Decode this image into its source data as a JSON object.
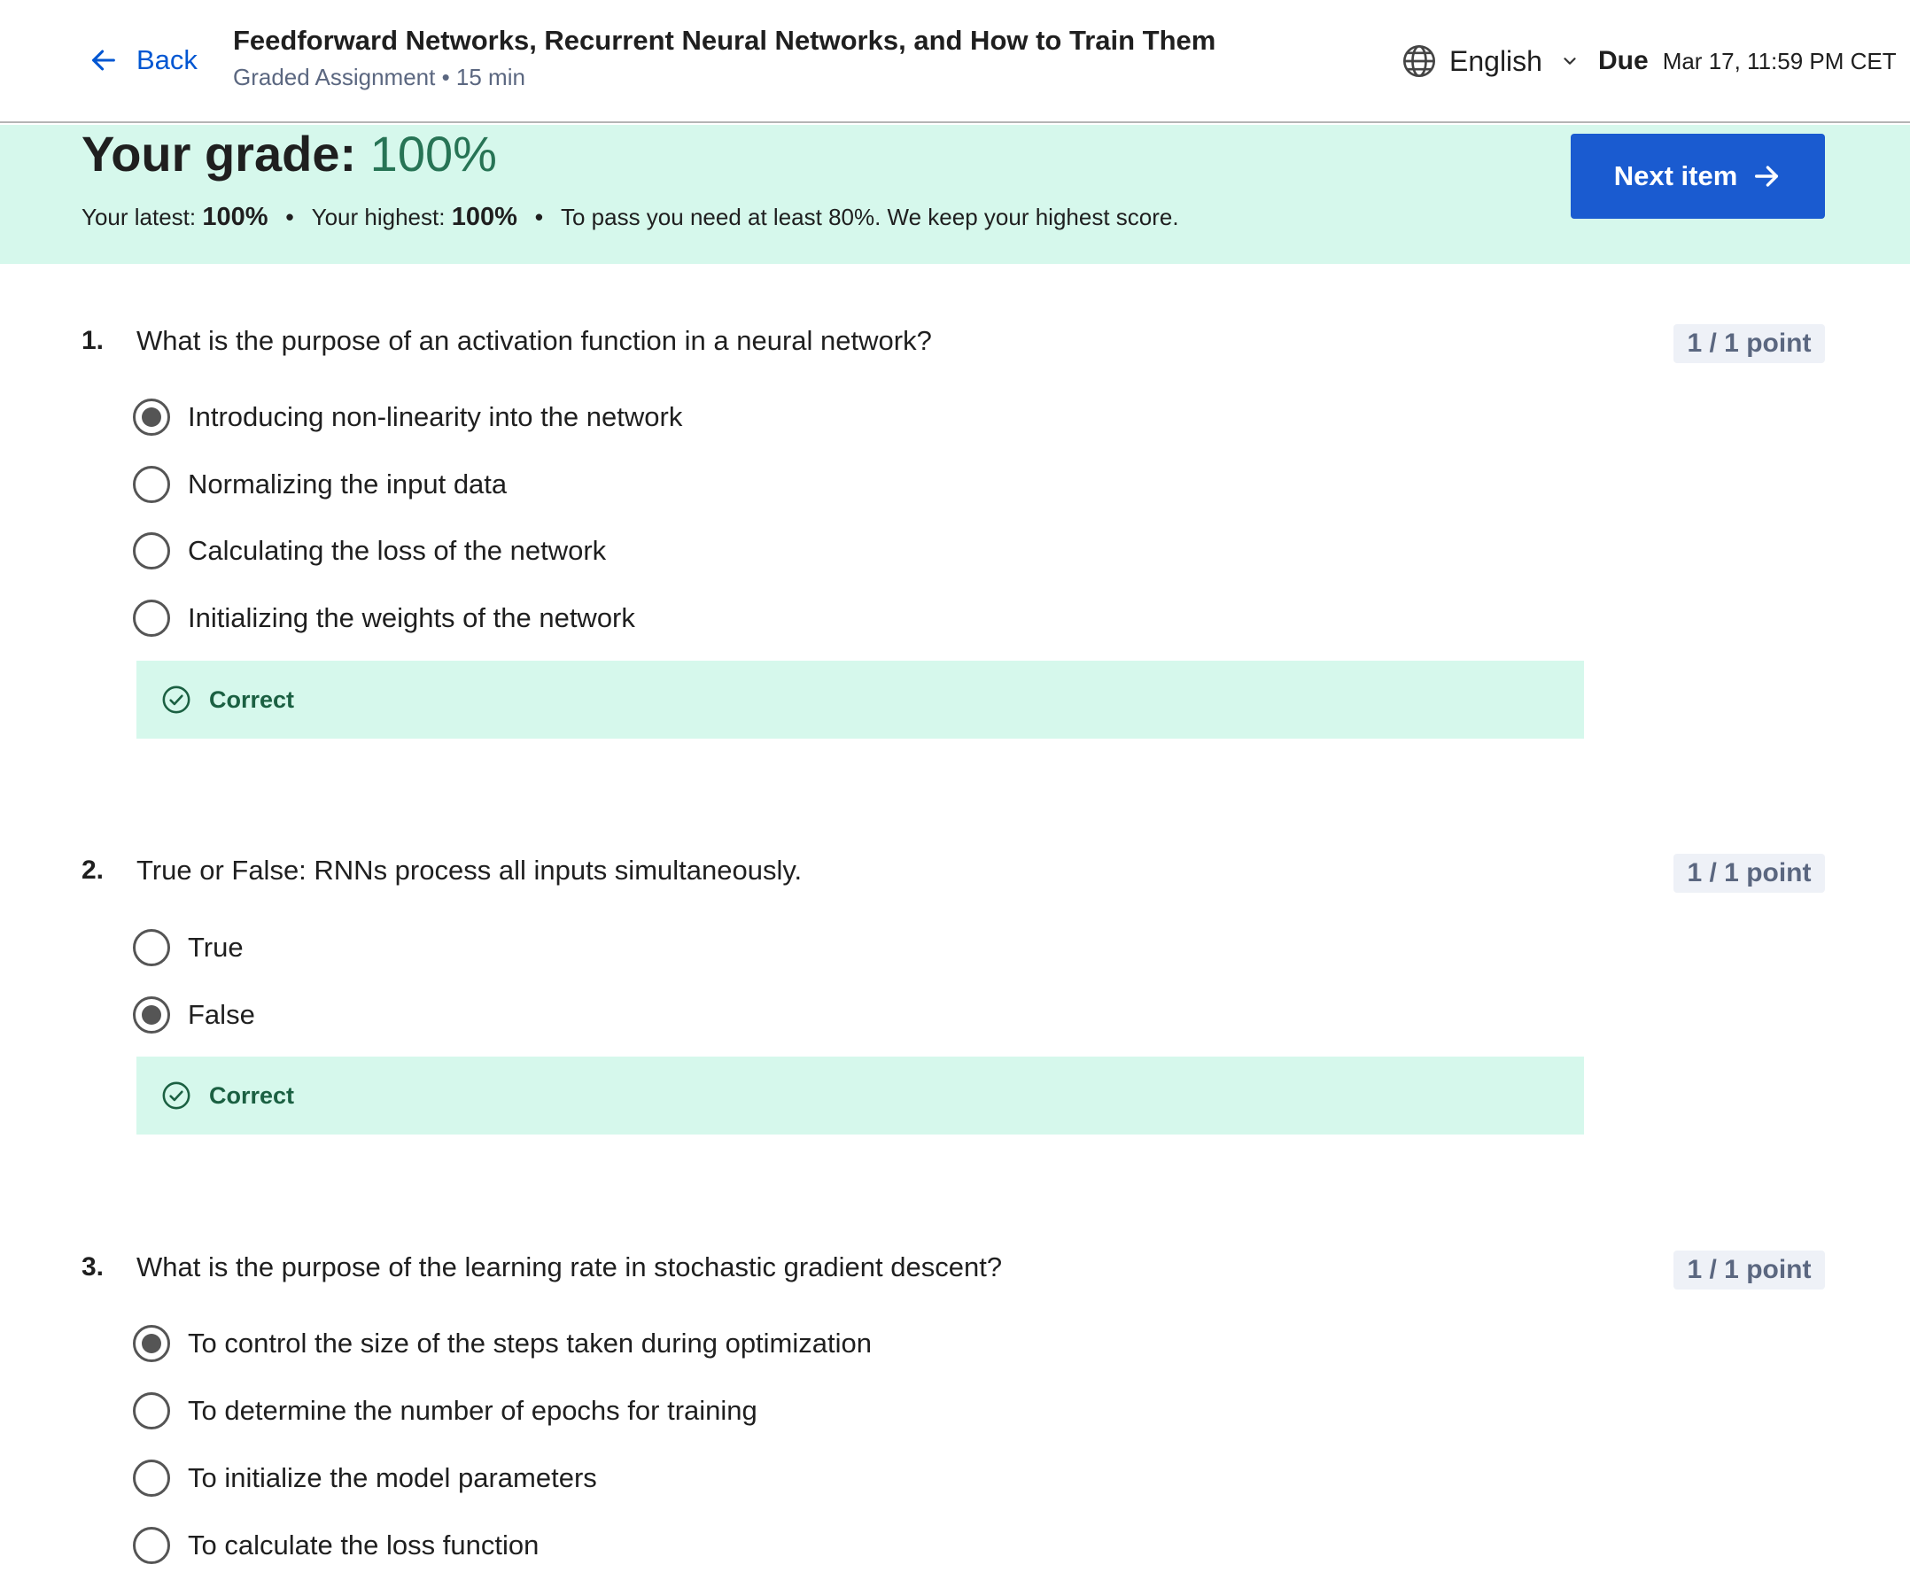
{
  "header": {
    "back_label": "Back",
    "title": "Feedforward Networks, Recurrent Neural Networks, and How to Train Them",
    "subtitle": "Graded Assignment • 15 min",
    "language": "English",
    "due_label": "Due",
    "due_date": "Mar 17, 11:59 PM CET"
  },
  "grade": {
    "title_prefix": "Your grade: ",
    "percent": "100%",
    "latest_label": "Your latest: ",
    "latest_value": "100%",
    "highest_label": "Your highest: ",
    "highest_value": "100%",
    "pass_note": "To pass you need at least 80%. We keep your highest score.",
    "next_label": "Next item"
  },
  "questions": [
    {
      "number": "1.",
      "text": "What is the purpose of an activation function in a neural network?",
      "points": "1 / 1 point",
      "options": [
        {
          "label": "Introducing non-linearity into the network",
          "selected": true
        },
        {
          "label": "Normalizing the input data",
          "selected": false
        },
        {
          "label": "Calculating the loss of the network",
          "selected": false
        },
        {
          "label": "Initializing the weights of the network",
          "selected": false
        }
      ],
      "feedback": "Correct"
    },
    {
      "number": "2.",
      "text": "True or False: RNNs process all inputs simultaneously.",
      "points": "1 / 1 point",
      "options": [
        {
          "label": "True",
          "selected": false
        },
        {
          "label": "False",
          "selected": true
        }
      ],
      "feedback": "Correct"
    },
    {
      "number": "3.",
      "text": "What is the purpose of the learning rate in stochastic gradient descent?",
      "points": "1 / 1 point",
      "options": [
        {
          "label": "To control the size of the steps taken during optimization",
          "selected": true
        },
        {
          "label": "To determine the number of epochs for training",
          "selected": false
        },
        {
          "label": "To initialize the model parameters",
          "selected": false
        },
        {
          "label": "To calculate the loss function",
          "selected": false
        }
      ]
    }
  ],
  "colors": {
    "accent": "#0056d2",
    "success_bg": "#d6f8ec",
    "success_text": "#1b6042",
    "grade_green": "#277455"
  },
  "icons": {
    "back": "arrow-left-icon",
    "language": "globe-icon",
    "dropdown": "chevron-down-icon",
    "next": "arrow-right-icon",
    "feedback": "check-circle-icon"
  }
}
